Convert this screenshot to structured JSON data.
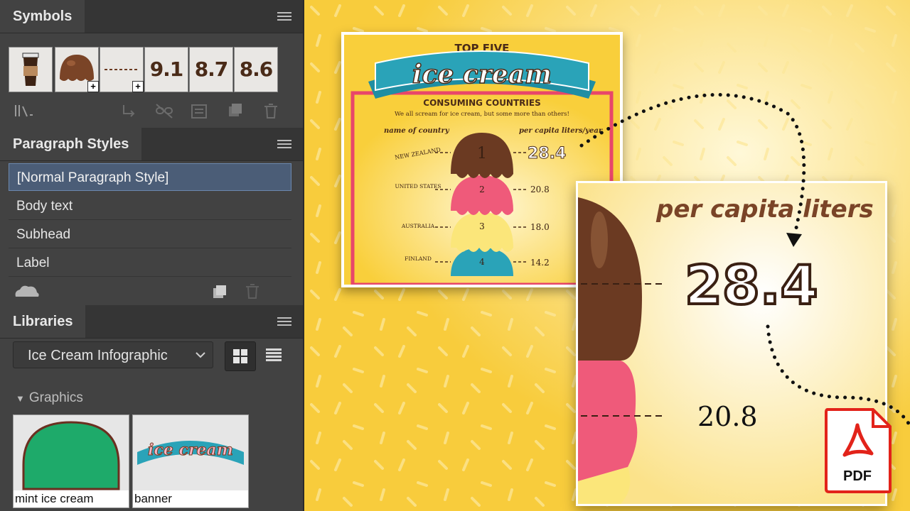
{
  "panels": {
    "symbols": {
      "tab": "Symbols",
      "values": [
        "9.1",
        "8.7",
        "8.6"
      ]
    },
    "paragraph_styles": {
      "tab": "Paragraph Styles",
      "items": [
        {
          "label": "[Normal Paragraph Style]"
        },
        {
          "label": "Body text"
        },
        {
          "label": "Subhead"
        },
        {
          "label": "Label"
        }
      ]
    },
    "libraries": {
      "tab": "Libraries",
      "selected_library": "Ice Cream Infographic",
      "section_label": "Graphics",
      "graphics": [
        {
          "caption": "mint ice cream"
        },
        {
          "caption": "banner"
        }
      ]
    }
  },
  "infographic": {
    "top_line": "TOP FIVE",
    "banner": "ice cream",
    "subtitle": "CONSUMING COUNTRIES",
    "tagline": "We all scream for ice cream, but some more than others!",
    "col_left": "name of country",
    "col_right": "per capita liters/year",
    "rows": [
      {
        "rank": "1",
        "country": "NEW ZEALAND",
        "value": "28.4"
      },
      {
        "rank": "2",
        "country": "UNITED STATES",
        "value": "20.8"
      },
      {
        "rank": "3",
        "country": "AUSTRALIA",
        "value": "18.0"
      },
      {
        "rank": "4",
        "country": "FINLAND",
        "value": "14.2"
      }
    ]
  },
  "zoom": {
    "heading": "per capita liters",
    "big_value": "28.4",
    "second_value": "20.8"
  },
  "pdf_badge": "PDF",
  "colors": {
    "panel_bg": "#424242",
    "tab_bar": "#353535",
    "selection": "#4b5d77",
    "background_yellow": "#fad452",
    "chocolate": "#6b3a22",
    "strawberry": "#ef5a7a",
    "lemon": "#fbe67a",
    "teal": "#2aa3b8",
    "mint": "#1eaa6a",
    "pdf_red": "#e2231a"
  }
}
